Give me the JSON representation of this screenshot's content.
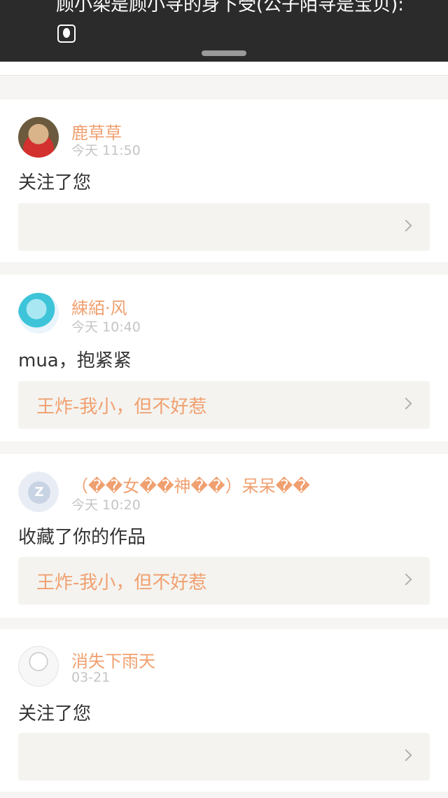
{
  "banner": {
    "text": "顾小染是顾小寻的身下受(公子陌寻是宝贝):"
  },
  "items": [
    {
      "name": "鹿草草",
      "time": "今天 11:50",
      "message": "关注了您",
      "reference": ""
    },
    {
      "name": "綀絔·风",
      "time": "今天 10:40",
      "message": "mua，抱紧紧",
      "reference": "王炸-我小，但不好惹"
    },
    {
      "name": "（��女��神��）呆呆��",
      "time": "今天 10:20",
      "message": "收藏了你的作品",
      "reference": "王炸-我小，但不好惹"
    },
    {
      "name": "消失下雨天",
      "time": "03-21",
      "message": "关注了您",
      "reference": ""
    }
  ],
  "colors": {
    "accent": "#f0a070",
    "banner_bg": "#2b2b2b",
    "ref_bg": "#f4f3ef"
  },
  "icons": [
    "alien-emoji-icon",
    "chevron-right-icon",
    "qq-default-avatar-icon"
  ]
}
